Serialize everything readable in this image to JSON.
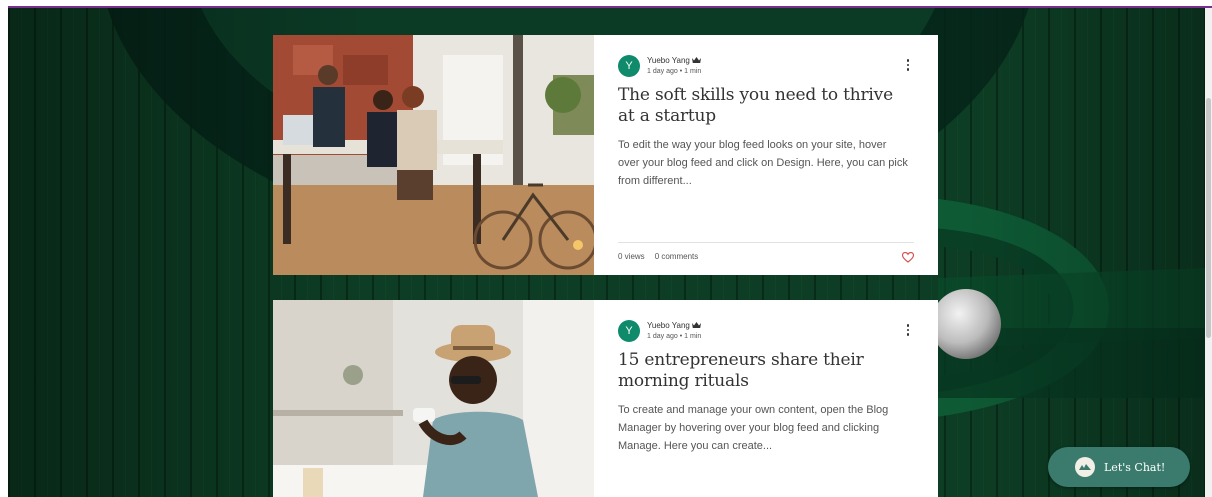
{
  "posts": [
    {
      "avatar_letter": "Y",
      "author": "Yuebo Yang",
      "date": "1 day ago",
      "read_time": "1 min",
      "title": "The soft skills you need to thrive at a startup",
      "excerpt": "To edit the way your blog feed looks on your site, hover over your blog feed and click on Design. Here, you can pick from different...",
      "views": "0 views",
      "comments": "0 comments"
    },
    {
      "avatar_letter": "Y",
      "author": "Yuebo Yang",
      "date": "1 day ago",
      "read_time": "1 min",
      "title": "15 entrepreneurs share their morning rituals",
      "excerpt": "To create and manage your own content, open the Blog Manager by hovering over your blog feed and clicking Manage. Here you can create..."
    }
  ],
  "chat": {
    "label": "Let's Chat!"
  },
  "colors": {
    "background": "#0c3a22",
    "avatar": "#0f8a6a",
    "chat_button": "#3b7b6e",
    "heart": "#d9534f",
    "top_accent": "#7a2e8e"
  },
  "icons": {
    "crown": "crown-icon",
    "more": "more-options-icon",
    "heart": "heart-icon",
    "chat_logo": "chat-logo-icon"
  }
}
